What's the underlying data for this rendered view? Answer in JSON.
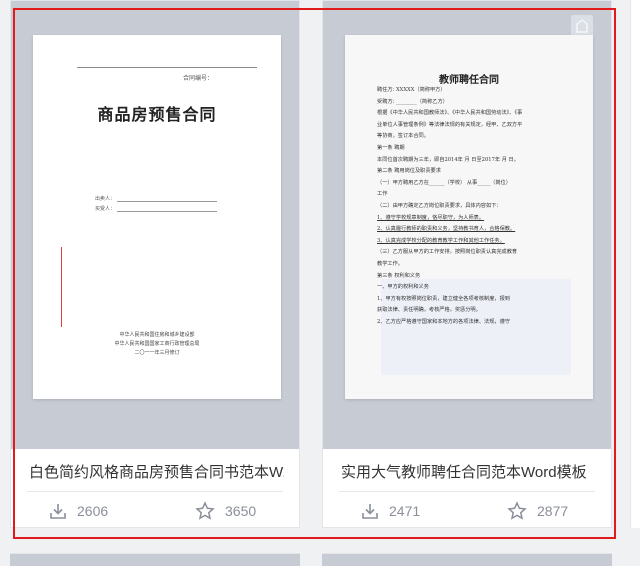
{
  "cards": [
    {
      "title": "白色简约风格商品房预售合同书范本W...",
      "downloads": "2606",
      "favorites": "3650",
      "doc": {
        "contract_no_label": "合同编号：",
        "heading": "商品房预售合同",
        "seller_label": "出卖人：",
        "buyer_label": "买受人：",
        "footer_lines": [
          "中华人民共和国住房和城乡建设部",
          "中华人民共和国国家工商行政管理总局",
          "二〇一一年三月修订"
        ]
      }
    },
    {
      "title": "实用大气教师聘任合同范本Word模板",
      "downloads": "2471",
      "favorites": "2877",
      "doc": {
        "heading": "教师聘任合同",
        "lines": [
          "聘任方: XXXXX（简称甲方）",
          "受聘方: ________（简称乙方）",
          "根据《中华人民共和国教师法》、《中华人民共和国劳动法》、《事",
          "业单位人事管理条例》等法律法规的有关规定，经甲、乙双方平",
          "等协商，签订本合同。",
          "第一条  聘期",
          "本同位首次聘期为三年，即自2014年  月 日至2017年 月 日。",
          "第二条  聘用岗位及职责要求",
          "（一）甲方聘用乙方在______（学校） 从事_____（岗位）",
          "工作",
          "（二）由甲方确定乙方岗位职责要求，具体内容如下：",
          "1、遵守学校规章制度，恪尽职守，为人师表。",
          "2、认真履行教师的职责和义务，坚持教书育人，合格保教。",
          "3、认真完成学校分配的教育教学工作和其他工作任务。",
          "（三）乙方服从甲方的工作安排，按照岗位职责认真完成教育",
          "教学工作。",
          "第三条  权利和义务",
          "一、甲方的权利和义务",
          "1、甲方有权按照岗位职责，建立健全各项考核制度，报到",
          "获取法律、责任明确，考核严格，奖惩分明。",
          "2、乙方应严格遵守国家和本地方的各项法律、法规，遵守"
        ]
      }
    }
  ]
}
